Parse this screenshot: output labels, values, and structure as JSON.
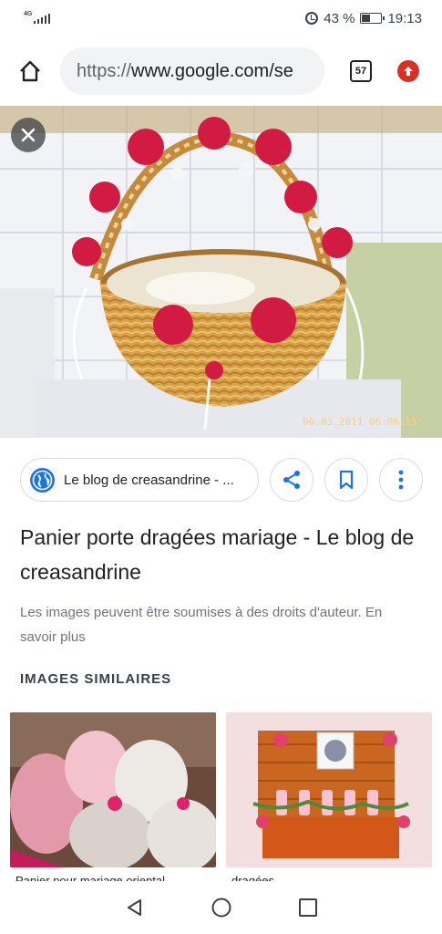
{
  "status_bar": {
    "network": "4G",
    "battery_percent": "43 %",
    "battery_level": 0.43,
    "time": "19:13"
  },
  "url_bar": {
    "scheme": "https://",
    "url_text": "www.google.com/se",
    "tab_count": "57"
  },
  "hero": {
    "image_date_stamp": "06.03.2011 06:06:55"
  },
  "source": {
    "label": "Le blog de creasandrine - ..."
  },
  "result": {
    "title": "Panier porte dragées mariage - Le blog de creasandrine",
    "copyright_notice": "Les images peuvent être soumises à des droits d'auteur. En savoir plus"
  },
  "similar": {
    "heading": "IMAGES SIMILAIRES",
    "items": [
      {
        "caption": "Panier pour mariage oriental"
      },
      {
        "caption": "dragées"
      }
    ]
  },
  "colors": {
    "accent_blue": "#1a73e8",
    "update_red": "#d93025",
    "chip_border": "#dadce0"
  },
  "icons": {
    "home": "home-icon",
    "update": "arrow-up-icon",
    "close": "close-icon",
    "share": "share-icon",
    "save": "bookmark-icon",
    "more": "more-vert-icon",
    "back": "back-triangle-icon",
    "home_nav": "circle-icon",
    "recents": "square-icon"
  }
}
